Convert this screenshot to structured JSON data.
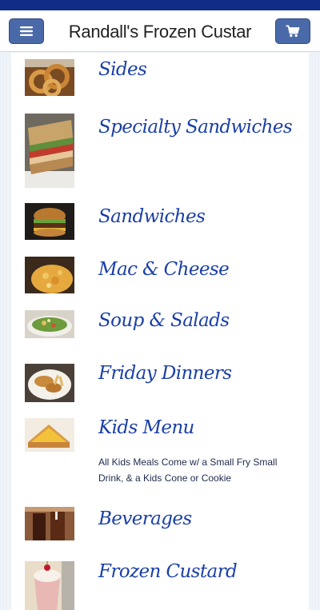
{
  "header": {
    "title": "Randall's Frozen Custar",
    "menu_icon": "hamburger-menu-icon",
    "cart_icon": "shopping-cart-icon"
  },
  "colors": {
    "topbar": "#0f2c86",
    "button": "#4a69a8",
    "category_text": "#1a3fa6"
  },
  "categories": [
    {
      "label": "Sides",
      "image": "onion-rings-photo"
    },
    {
      "label": "Specialty Sandwiches",
      "image": "panini-sandwich-photo"
    },
    {
      "label": "Sandwiches",
      "image": "burger-photo"
    },
    {
      "label": "Mac & Cheese",
      "image": "mac-and-cheese-photo"
    },
    {
      "label": "Soup & Salads",
      "image": "salad-photo"
    },
    {
      "label": "Friday Dinners",
      "image": "fish-dinner-photo"
    },
    {
      "label": "Kids Menu",
      "image": "grilled-cheese-photo",
      "description": "All Kids Meals Come w/ a Small Fry Small Drink, & a Kids Cone or Cookie"
    },
    {
      "label": "Beverages",
      "image": "soft-drink-photo"
    },
    {
      "label": "Frozen Custard",
      "image": "milkshake-photo"
    }
  ]
}
